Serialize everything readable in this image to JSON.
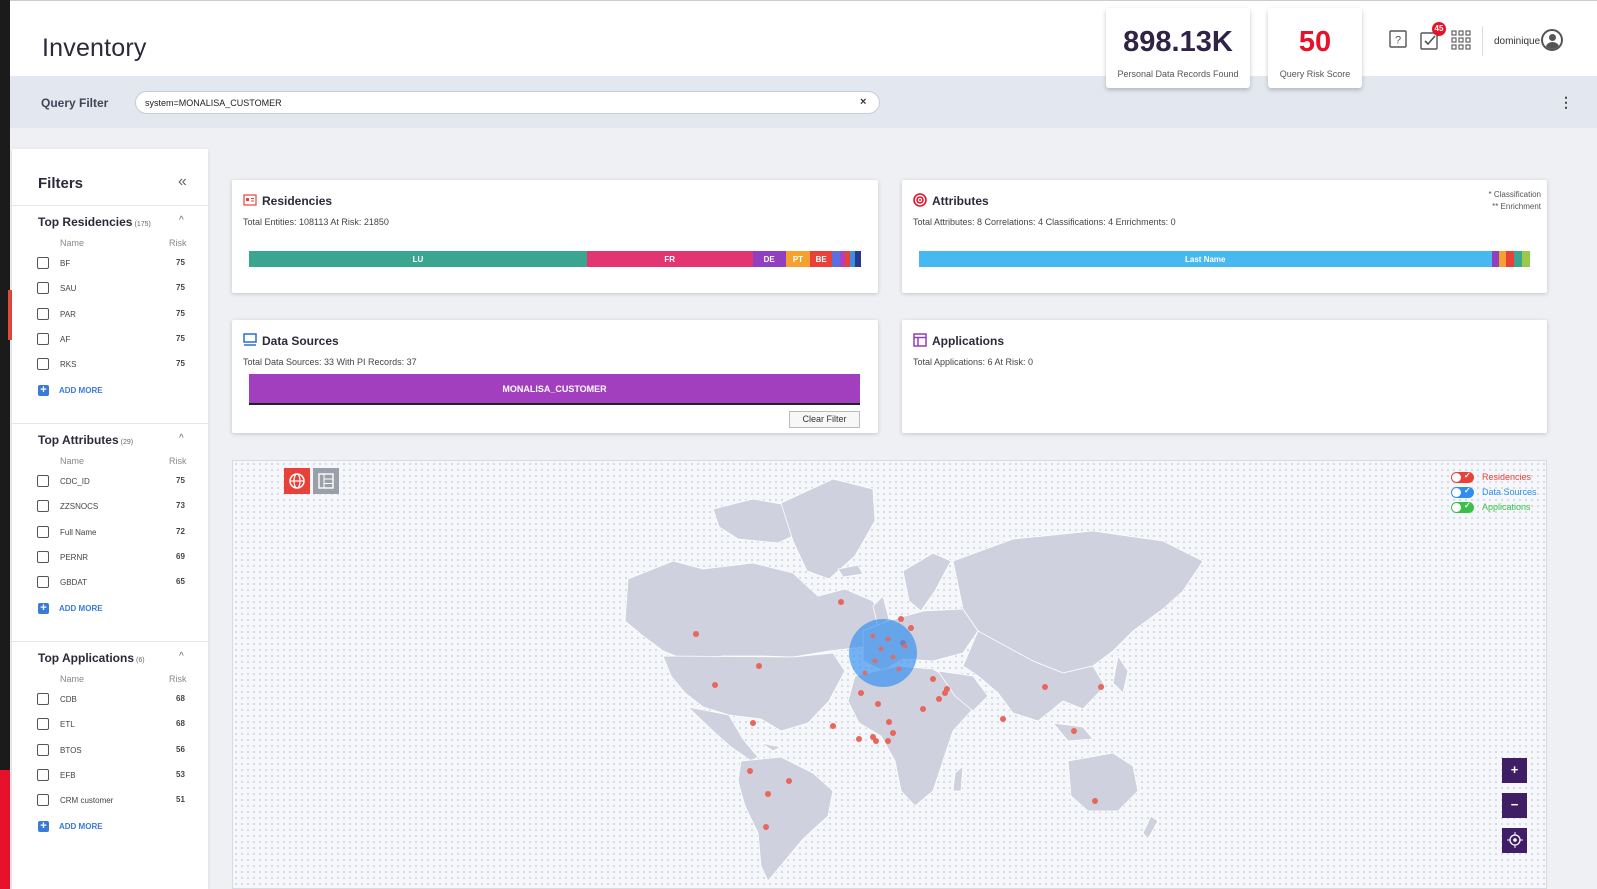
{
  "header": {
    "title": "Inventory",
    "kpis": [
      {
        "value": "898.13K",
        "label": "Personal Data Records Found",
        "color": "#2f2346"
      },
      {
        "value": "50",
        "label": "Query Risk Score",
        "color": "#e8112b"
      }
    ],
    "icons": [
      "help-icon",
      "tasks-icon",
      "apps-grid-icon"
    ],
    "tasks_badge": "45",
    "user": "dominique"
  },
  "query": {
    "label": "Query Filter",
    "value": "system=MONALISA_CUSTOMER",
    "clear": "×"
  },
  "filters": {
    "title": "Filters",
    "collapse": "«",
    "name_col": "Name",
    "risk_col": "Risk",
    "add_more": "ADD MORE",
    "groups": [
      {
        "title": "Top Residencies",
        "count": "(175)",
        "rows": [
          {
            "name": "BF",
            "risk": "75"
          },
          {
            "name": "SAU",
            "risk": "75"
          },
          {
            "name": "PAR",
            "risk": "75"
          },
          {
            "name": "AF",
            "risk": "75"
          },
          {
            "name": "RKS",
            "risk": "75"
          }
        ]
      },
      {
        "title": "Top Attributes",
        "count": "(29)",
        "rows": [
          {
            "name": "CDC_ID",
            "risk": "75"
          },
          {
            "name": "ZZSNOCS",
            "risk": "73"
          },
          {
            "name": "Full Name",
            "risk": "72"
          },
          {
            "name": "PERNR",
            "risk": "69"
          },
          {
            "name": "GBDAT",
            "risk": "65"
          }
        ]
      },
      {
        "title": "Top Applications",
        "count": "(6)",
        "rows": [
          {
            "name": "CDB",
            "risk": "68"
          },
          {
            "name": "ETL",
            "risk": "68"
          },
          {
            "name": "BTOS",
            "risk": "56"
          },
          {
            "name": "EFB",
            "risk": "53"
          },
          {
            "name": "CRM customer",
            "risk": "51"
          }
        ]
      }
    ]
  },
  "residencies": {
    "title": "Residencies",
    "summary": "Total Entities: 108113 At Risk: 21850",
    "segments": [
      {
        "label": "LU",
        "pct": 55.2,
        "color": "#3aa68f"
      },
      {
        "label": "FR",
        "pct": 27.1,
        "color": "#e43573"
      },
      {
        "label": "DE",
        "pct": 5.4,
        "color": "#8f3fbf"
      },
      {
        "label": "PT",
        "pct": 4.0,
        "color": "#f4a130"
      },
      {
        "label": "BE",
        "pct": 3.6,
        "color": "#e8413a"
      },
      {
        "label": "",
        "pct": 1.3,
        "color": "#5a6fe0"
      },
      {
        "label": "",
        "pct": 0.8,
        "color": "#b040c0"
      },
      {
        "label": "",
        "pct": 0.8,
        "color": "#e8413a"
      },
      {
        "label": "",
        "pct": 0.9,
        "color": "#3a8fe0"
      },
      {
        "label": "",
        "pct": 0.9,
        "color": "#2a3a8a"
      }
    ]
  },
  "attributes": {
    "title": "Attributes",
    "summary": "Total Attributes: 8  Correlations: 4  Classifications: 4  Enrichments: 0",
    "note1": "* Classification",
    "note2": "** Enrichment",
    "segments": [
      {
        "label": "Last Name",
        "pct": 93.7,
        "color": "#48b8f0"
      },
      {
        "label": "",
        "pct": 1.2,
        "color": "#8f3fbf"
      },
      {
        "label": "",
        "pct": 1.2,
        "color": "#f4a130"
      },
      {
        "label": "",
        "pct": 1.3,
        "color": "#e8413a"
      },
      {
        "label": "",
        "pct": 1.3,
        "color": "#3aa68f"
      },
      {
        "label": "",
        "pct": 1.3,
        "color": "#9bc94a"
      }
    ]
  },
  "datasources": {
    "title": "Data Sources",
    "summary": "Total Data Sources: 33 With PI Records: 37",
    "bar_label": "MONALISA_CUSTOMER",
    "clear_button": "Clear Filter"
  },
  "applications": {
    "title": "Applications",
    "summary": "Total Applications: 6 At Risk: 0"
  },
  "map": {
    "legend": [
      {
        "label": "Residencies",
        "color": "#e8413a"
      },
      {
        "label": "Data Sources",
        "color": "#2f8ef0"
      },
      {
        "label": "Applications",
        "color": "#3ac04a"
      }
    ],
    "zoom_in": "+",
    "zoom_out": "−",
    "view_buttons": [
      "globe-icon",
      "table-icon"
    ]
  }
}
